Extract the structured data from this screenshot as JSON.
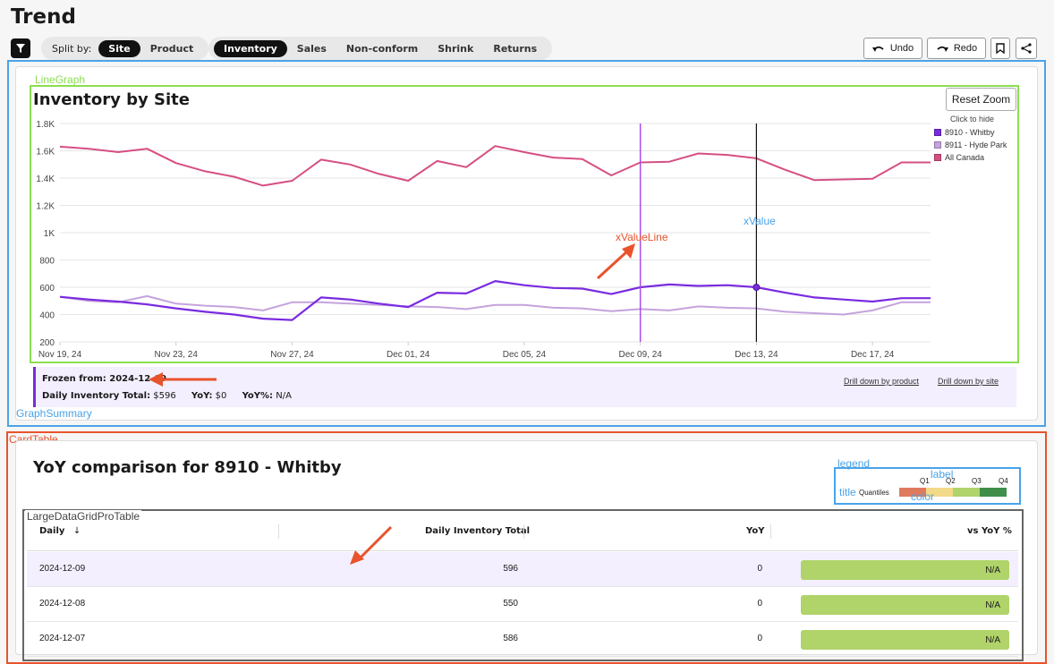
{
  "page": {
    "title": "Trend"
  },
  "toolbar": {
    "split_label": "Split by:",
    "split_options": [
      {
        "label": "Site",
        "active": true
      },
      {
        "label": "Product",
        "active": false
      }
    ],
    "metric_tabs": [
      {
        "label": "Inventory",
        "active": true
      },
      {
        "label": "Sales",
        "active": false
      },
      {
        "label": "Non-conform",
        "active": false
      },
      {
        "label": "Shrink",
        "active": false
      },
      {
        "label": "Returns",
        "active": false
      }
    ],
    "undo": "Undo",
    "redo": "Redo"
  },
  "annotations": {
    "line_graph": "LineGraph",
    "x_value_line": "xValueLine",
    "x_value": "xValue",
    "graph_summary": "GraphSummary",
    "card_table": "CardTable",
    "legend": "legend",
    "label": "label",
    "title": "title",
    "color": "color",
    "large_grid": "LargeDataGridProTable"
  },
  "chart_header": {
    "title": "Inventory by Site",
    "reset_zoom": "Reset Zoom",
    "legend_hint": "Click to hide"
  },
  "chart_data": {
    "type": "line",
    "title": "Inventory by Site",
    "x": [
      "2024-11-19",
      "2024-11-20",
      "2024-11-21",
      "2024-11-22",
      "2024-11-23",
      "2024-11-24",
      "2024-11-25",
      "2024-11-26",
      "2024-11-27",
      "2024-11-28",
      "2024-11-29",
      "2024-11-30",
      "2024-12-01",
      "2024-12-02",
      "2024-12-03",
      "2024-12-04",
      "2024-12-05",
      "2024-12-06",
      "2024-12-07",
      "2024-12-08",
      "2024-12-09",
      "2024-12-10",
      "2024-12-11",
      "2024-12-12",
      "2024-12-13",
      "2024-12-14",
      "2024-12-15",
      "2024-12-16",
      "2024-12-17",
      "2024-12-18",
      "2024-12-19"
    ],
    "tick_labels": [
      "Nov 19, 24",
      "Nov 23, 24",
      "Nov 27, 24",
      "Dec 01, 24",
      "Dec 05, 24",
      "Dec 09, 24",
      "Dec 13, 24",
      "Dec 17, 24"
    ],
    "y_ticks": [
      "200",
      "400",
      "600",
      "800",
      "1K",
      "1.2K",
      "1.4K",
      "1.6K",
      "1.8K"
    ],
    "ylim": [
      200,
      1800
    ],
    "series": [
      {
        "name": "8910 - Whitby",
        "color": "#7a2be0",
        "values": [
          530,
          510,
          495,
          475,
          445,
          420,
          400,
          370,
          360,
          525,
          510,
          480,
          455,
          560,
          555,
          645,
          615,
          595,
          590,
          550,
          600,
          620,
          610,
          615,
          600,
          560,
          525,
          510,
          495,
          520,
          520
        ]
      },
      {
        "name": "8911 - Hyde Park",
        "color": "#c5a3dd",
        "values": [
          530,
          500,
          490,
          535,
          480,
          465,
          455,
          430,
          490,
          490,
          480,
          470,
          460,
          455,
          440,
          470,
          470,
          450,
          445,
          425,
          440,
          430,
          460,
          450,
          445,
          420,
          410,
          400,
          430,
          490,
          490
        ]
      },
      {
        "name": "All Canada",
        "color": "#d64f83",
        "values": [
          1630,
          1615,
          1590,
          1615,
          1510,
          1450,
          1410,
          1345,
          1380,
          1535,
          1500,
          1430,
          1380,
          1525,
          1480,
          1635,
          1590,
          1550,
          1540,
          1420,
          1515,
          1520,
          1580,
          1570,
          1545,
          1460,
          1385,
          1390,
          1395,
          1515,
          1515
        ]
      }
    ],
    "frozen_x": "2024-12-09",
    "hover_x": "2024-12-13",
    "legend_position": "top-right"
  },
  "summary": {
    "frozen_label": "Frozen from:",
    "frozen_value": "2024-12-09",
    "total_label": "Daily Inventory Total:",
    "total_value": "$596",
    "yoy_label": "YoY:",
    "yoy_value": "$0",
    "yoy_pct_label": "YoY%:",
    "yoy_pct_value": "N/A",
    "drill_product": "Drill down by product",
    "drill_site": "Drill down by site"
  },
  "table": {
    "title": "YoY comparison for 8910 - Whitby",
    "quantiles": {
      "title": "Quantiles",
      "labels": [
        "Q1",
        "Q2",
        "Q3",
        "Q4"
      ],
      "colors": [
        "#e07a5f",
        "#f3d98a",
        "#b0d36a",
        "#3f8f4a"
      ]
    },
    "headers": [
      "Daily",
      "Daily Inventory Total",
      "YoY",
      "vs YoY %"
    ],
    "sort_indicator": "↓",
    "rows": [
      {
        "date": "2024-12-09",
        "total": "596",
        "yoy": "0",
        "pct": "N/A",
        "selected": true
      },
      {
        "date": "2024-12-08",
        "total": "550",
        "yoy": "0",
        "pct": "N/A",
        "selected": false
      },
      {
        "date": "2024-12-07",
        "total": "586",
        "yoy": "0",
        "pct": "N/A",
        "selected": false
      }
    ],
    "bar_color": "#b0d36a"
  }
}
